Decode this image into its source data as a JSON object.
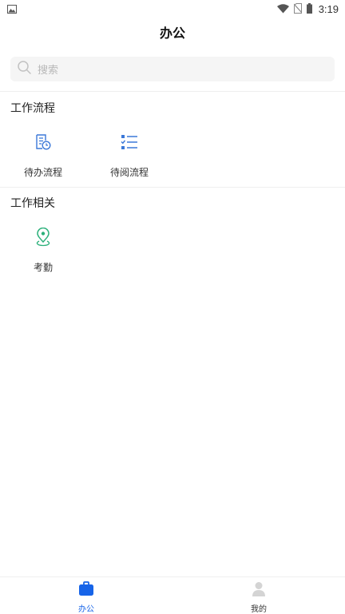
{
  "status_bar": {
    "time": "3:19",
    "icons": [
      "image-notification-icon",
      "wifi-icon",
      "no-sim-icon",
      "battery-icon"
    ]
  },
  "header": {
    "title": "办公"
  },
  "search": {
    "placeholder": "搜索"
  },
  "sections": [
    {
      "title": "工作流程",
      "items": [
        {
          "label": "待办流程",
          "icon": "pending-document-icon"
        },
        {
          "label": "待阅流程",
          "icon": "checklist-icon"
        }
      ]
    },
    {
      "title": "工作相关",
      "items": [
        {
          "label": "考勤",
          "icon": "location-pin-icon"
        }
      ]
    }
  ],
  "tab_bar": {
    "tabs": [
      {
        "label": "办公",
        "icon": "briefcase-icon",
        "active": true
      },
      {
        "label": "我的",
        "icon": "user-icon",
        "active": false
      }
    ]
  },
  "colors": {
    "accent": "#1764e8",
    "icon_blue": "#3b78d8",
    "icon_green": "#2bb07a",
    "search_bg": "#f5f5f5"
  }
}
